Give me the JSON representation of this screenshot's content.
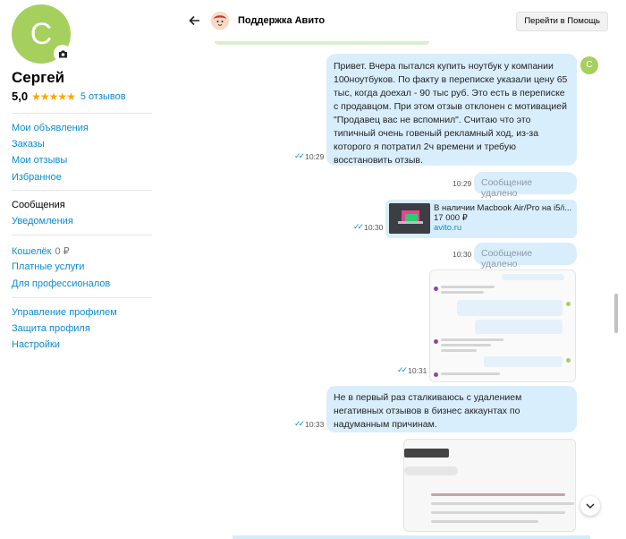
{
  "profile": {
    "avatar_letter": "С",
    "name": "Сергей",
    "rating": "5,0",
    "stars": "★★★★★",
    "reviews": "5 отзывов"
  },
  "nav": {
    "group1": [
      "Мои объявления",
      "Заказы",
      "Мои отзывы",
      "Избранное"
    ],
    "group2": [
      "Сообщения",
      "Уведомления"
    ],
    "group3": [
      "Кошелёк",
      "Платные услуги",
      "Для профессионалов"
    ],
    "wallet_amount": "0 ₽",
    "group4": [
      "Управление профилем",
      "Защита профиля",
      "Настройки"
    ]
  },
  "chat": {
    "title": "Поддержка Авито",
    "help_button": "Перейти в Помощь",
    "user_avatar_letter": "С",
    "messages": [
      {
        "text": "Привет. Вчера пытался купить ноутбук у компании 100ноутбуков. По факту в переписке указали цену 65 тыс, когда доехал - 90 тыс руб. Это есть в переписке с продавцом. При этом отзыв отклонен с мотивацией \"Продавец вас не вспомнил\". Считаю что это типичный очень говеный рекламный ход, из-за которого я потратил 2ч времени и требую восстановить отзыв.",
        "time": "10:29"
      },
      {
        "text": "Сообщение удалено",
        "time": "10:29"
      },
      {
        "title": "В наличии Macbook Air/Pro на i5/i...",
        "price": "17 000 ₽",
        "domain": "avito.ru",
        "time": "10:30"
      },
      {
        "text": "Сообщение удалено",
        "time": "10:30"
      },
      {
        "time": "10:31"
      },
      {
        "text": "Не в первый раз сталкиваюсь с удалением негативных отзывов в бизнес аккаунтах по надуманным причинам.",
        "time": "10:33"
      }
    ]
  },
  "colors": {
    "accent": "#0a8bd1",
    "bubble": "#d9eefc",
    "avatar": "#a6d05e",
    "star": "#ffa500"
  },
  "icons": {
    "camera": "camera-icon",
    "back": "arrow-left-icon",
    "ticks": "double-check-icon",
    "scroll": "chevron-down-icon"
  }
}
